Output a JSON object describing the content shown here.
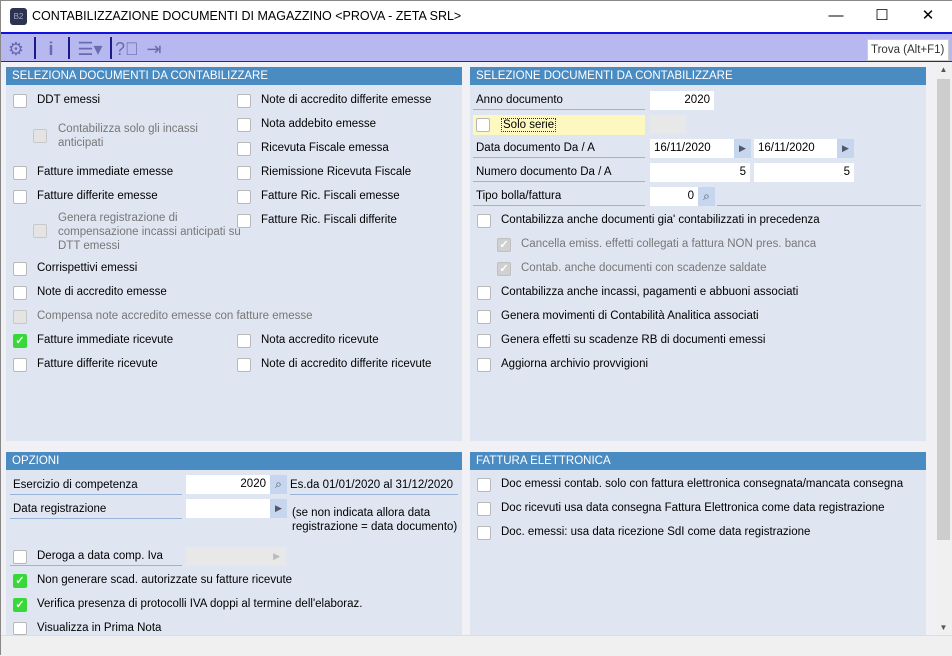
{
  "window": {
    "title": "CONTABILIZZAZIONE DOCUMENTI DI MAGAZZINO <PROVA - ZETA SRL>",
    "app_icon": "B2",
    "minimize": "—",
    "maximize": "☐",
    "close": "✕"
  },
  "toolbar": {
    "search_placeholder": "Trova (Alt+F1)",
    "icons": [
      "gears-icon",
      "info-icon",
      "menu-icon",
      "help-icon",
      "exit-icon"
    ]
  },
  "left_panel": {
    "title": "SELEZIONA DOCUMENTI DA CONTABILIZZARE",
    "col1": [
      {
        "label": "DDT emessi",
        "checked": false
      },
      {
        "label": "Contabilizza solo gli incassi",
        "label2": "anticipati",
        "checked": false,
        "disabled": true
      },
      {
        "label": "Fatture immediate emesse",
        "checked": false
      },
      {
        "label": "Fatture differite emesse",
        "checked": false
      },
      {
        "label": "Genera registrazione di",
        "label2": "compensazione incassi anticipati su",
        "label3": "DTT emessi",
        "checked": false,
        "disabled": true
      },
      {
        "label": "Corrispettivi emessi",
        "checked": false
      },
      {
        "label": "Note di accredito emesse",
        "checked": false
      },
      {
        "label": "Compensa note accredito emesse con fatture emesse",
        "checked": false,
        "disabled": true
      },
      {
        "label": "Fatture immediate ricevute",
        "checked": true
      },
      {
        "label": "Fatture differite ricevute",
        "checked": false
      }
    ],
    "col2": [
      {
        "label": "Note di accredito differite emesse",
        "checked": false
      },
      {
        "label": "Nota addebito emesse",
        "checked": false
      },
      {
        "label": "Ricevuta Fiscale emessa",
        "checked": false
      },
      {
        "label": "Riemissione Ricevuta Fiscale",
        "checked": false
      },
      {
        "label": "Fatture Ric. Fiscali emesse",
        "checked": false
      },
      {
        "label": "Fatture Ric. Fiscali differite",
        "checked": false
      },
      {
        "label": "Nota accredito ricevute",
        "checked": false
      },
      {
        "label": "Note di accredito differite ricevute",
        "checked": false
      }
    ]
  },
  "right_panel": {
    "title": "SELEZIONE DOCUMENTI DA CONTABILIZZARE",
    "anno_label": "Anno documento",
    "anno_value": "2020",
    "solo_serie_label": "Solo serie",
    "data_label": "Data documento Da / A",
    "data_da": "16/11/2020",
    "data_a": "16/11/2020",
    "numero_label": "Numero documento Da / A",
    "numero_da": "5",
    "numero_a": "5",
    "tipo_label": "Tipo bolla/fattura",
    "tipo_value": "0",
    "checks": [
      {
        "label": "Contabilizza anche documenti gia' contabilizzati in precedenza",
        "checked": false
      },
      {
        "label": "Cancella emiss. effetti collegati a fattura NON pres. banca",
        "checked": true,
        "disabled": true
      },
      {
        "label": "Contab. anche documenti con scadenze saldate",
        "checked": true,
        "disabled": true
      },
      {
        "label": "Contabilizza anche incassi, pagamenti e abbuoni associati",
        "checked": false
      },
      {
        "label": "Genera movimenti di Contabilità Analitica associati",
        "checked": false
      },
      {
        "label": "Genera effetti su scadenze RB di documenti emessi",
        "checked": false
      },
      {
        "label": "Aggiorna archivio provvigioni",
        "checked": false
      }
    ]
  },
  "options": {
    "title": "OPZIONI",
    "esercizio_label": "Esercizio di competenza",
    "esercizio_value": "2020",
    "esercizio_desc": "Es.da 01/01/2020 al 31/12/2020",
    "data_reg_label": "Data registrazione",
    "data_reg_value": "",
    "data_reg_note1": "(se non indicata  allora data",
    "data_reg_note2": "registrazione = data documento)",
    "deroga_label": "Deroga a data comp. Iva",
    "checks": [
      {
        "label": "Non generare scad. autorizzate su fatture ricevute",
        "checked": true
      },
      {
        "label": "Verifica presenza di protocolli IVA doppi al termine dell'elaboraz.",
        "checked": true
      },
      {
        "label": "Visualizza in Prima Nota",
        "checked": false
      }
    ]
  },
  "fattura_elettronica": {
    "title": "FATTURA ELETTRONICA",
    "checks": [
      {
        "label": "Doc emessi contab. solo con fattura elettronica consegnata/mancata consegna",
        "checked": false
      },
      {
        "label": "Doc ricevuti usa data consegna Fattura Elettronica come data registrazione",
        "checked": false
      },
      {
        "label": "Doc. emessi: usa data ricezione SdI come data registrazione",
        "checked": false
      }
    ]
  }
}
